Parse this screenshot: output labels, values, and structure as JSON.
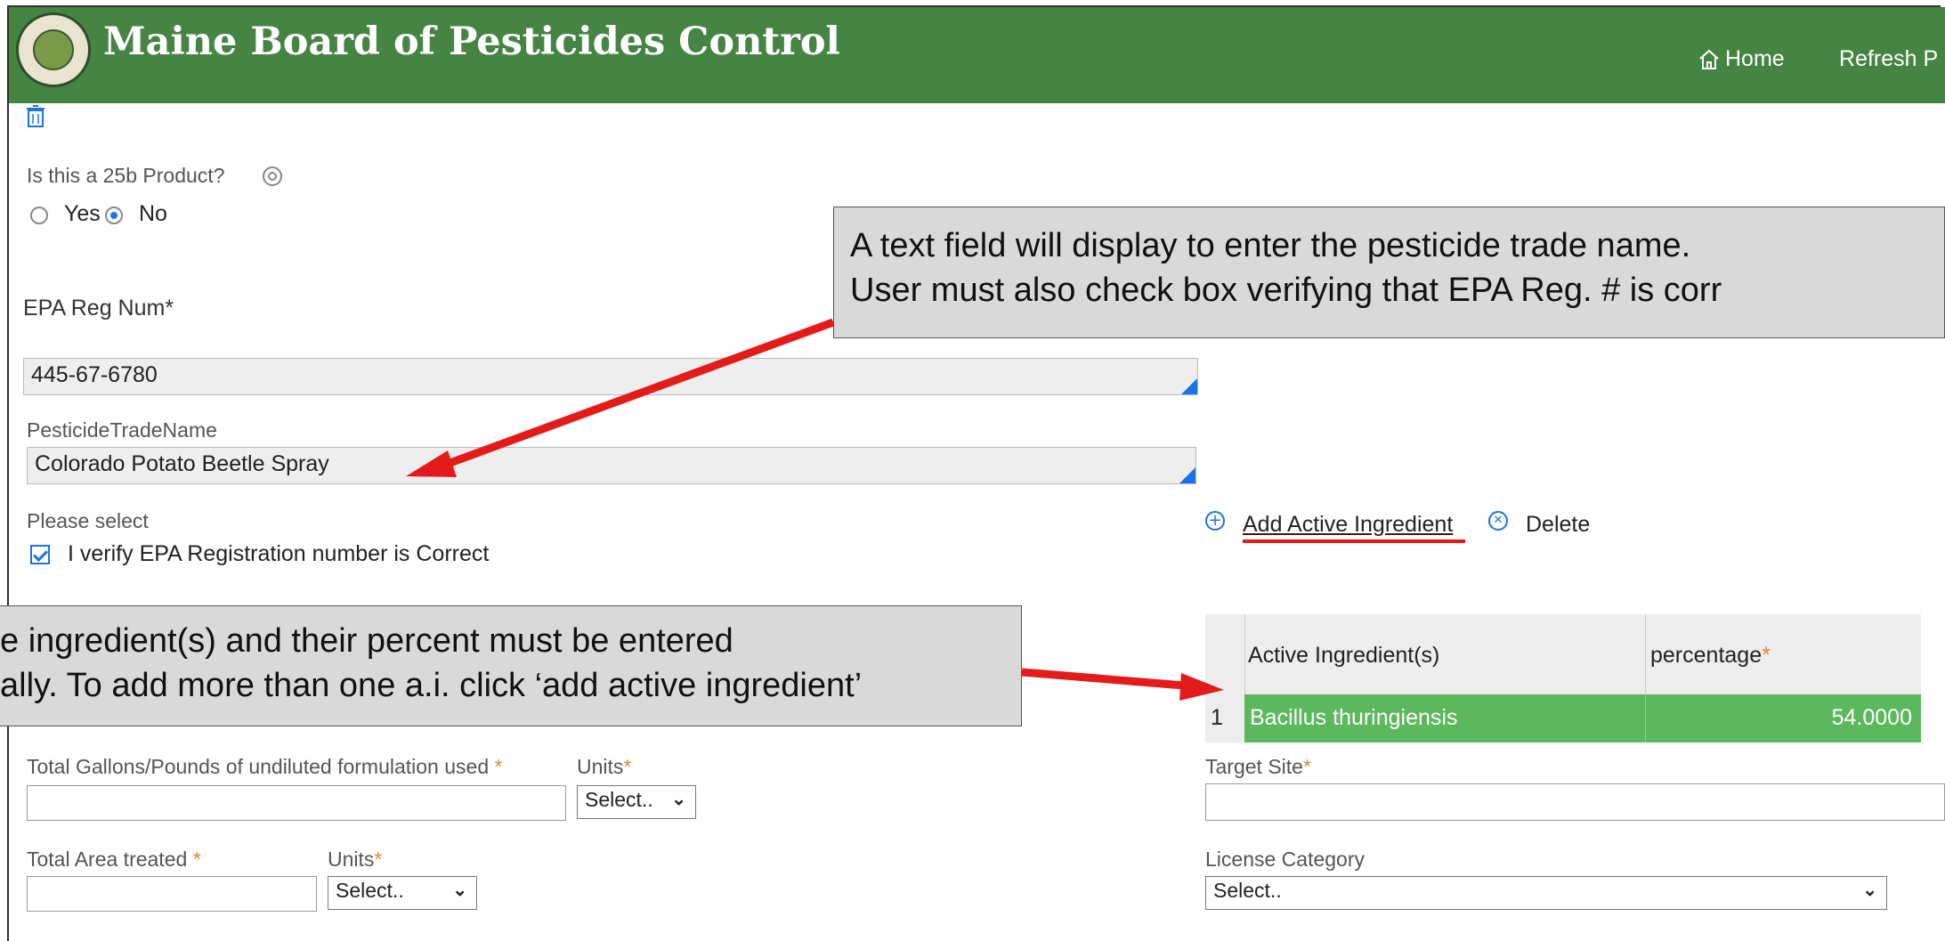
{
  "header": {
    "title": "Maine Board of Pesticides Control",
    "nav_home": "Home",
    "nav_refresh": "Refresh P"
  },
  "form": {
    "is_25b_label": "Is this a 25b Product?",
    "radio_yes": "Yes",
    "radio_no": "No",
    "radio_selected": "No",
    "epa_reg_label": "EPA Reg Num*",
    "epa_reg_value": "445-67-6780",
    "trade_name_label": "PesticideTradeName",
    "trade_name_value": "Colorado Potato Beetle Spray",
    "please_select_label": "Please select",
    "verify_label": "I verify EPA Registration number is Correct",
    "verify_checked": true,
    "total_gallons_label": "Total Gallons/Pounds of undiluted formulation used",
    "units_label": "Units",
    "units_select": "Select..",
    "total_area_label": "Total Area treated",
    "area_units_label": "Units",
    "area_units_select": "Select..",
    "target_site_label": "Target Site",
    "license_category_label": "License Category",
    "license_category_select": "Select.."
  },
  "ingredients": {
    "add_label": "Add Active Ingredient",
    "delete_label": "Delete",
    "columns": [
      "Active Ingredient(s)",
      "percentage"
    ],
    "rows": [
      {
        "index": "1",
        "name": "Bacillus thuringiensis",
        "percentage": "54.0000"
      }
    ],
    "row_color": "#5cb85c"
  },
  "callouts": {
    "top_line1": "A text field will display to enter the pesticide trade name.",
    "top_line2": "User must also check box verifying that EPA Reg. # is corr",
    "bottom_line1": "e ingredient(s) and their percent must be entered",
    "bottom_line2": "ally. To add more than one a.i. click ‘add active ingredient’"
  },
  "colors": {
    "header_bg": "#468443",
    "accent": "#1a73e8",
    "required_star": "#e08a2e",
    "arrow": "#e31b1b"
  }
}
